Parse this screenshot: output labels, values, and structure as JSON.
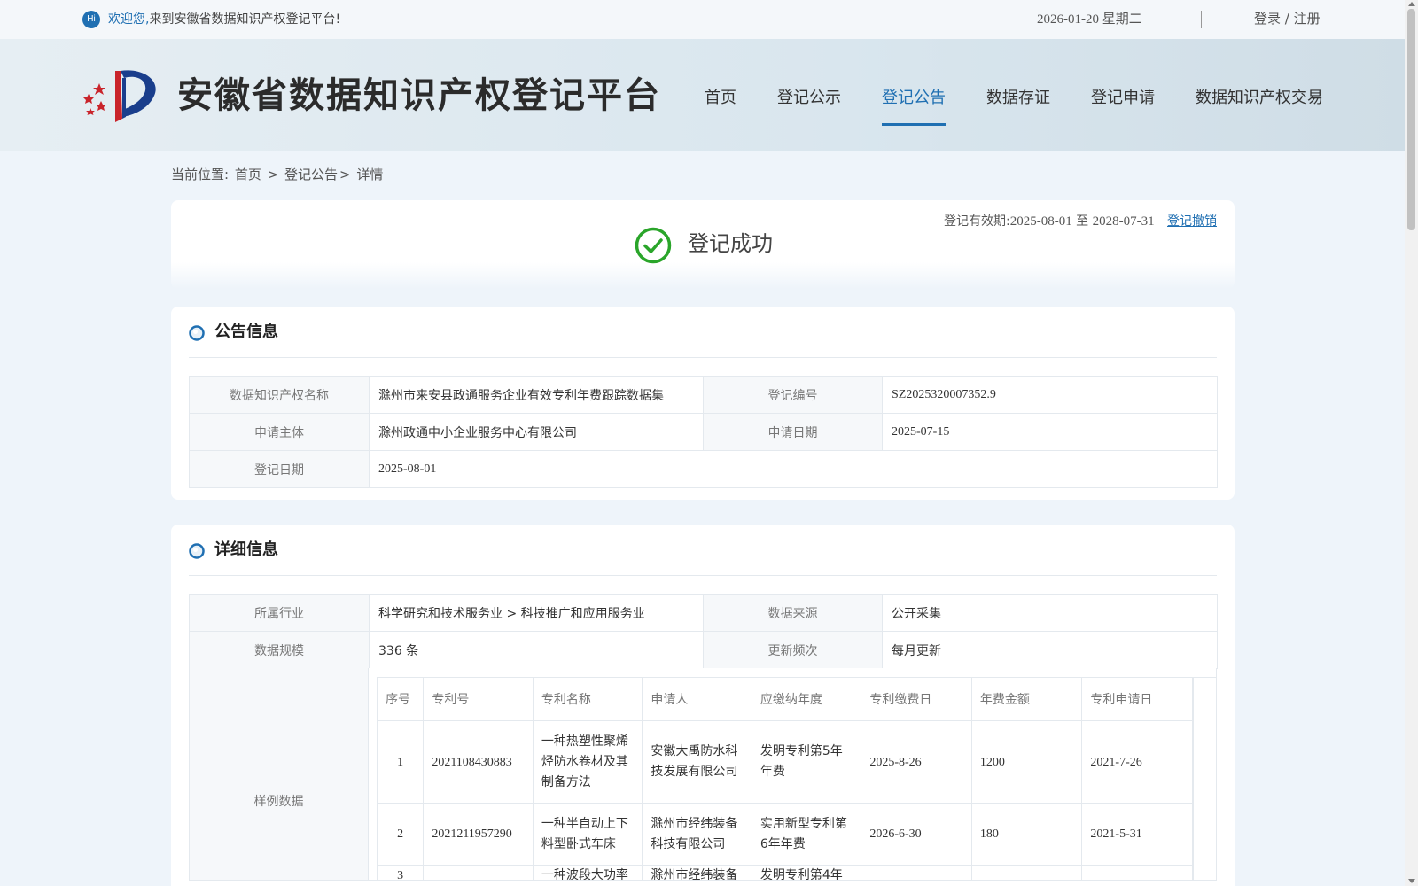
{
  "topbar": {
    "hi": "Hi",
    "welcome_highlight": "欢迎您,",
    "welcome_text": "来到安徽省数据知识产权登记平台!",
    "date": "2026-01-20 星期二",
    "separator": "|",
    "login": "登录 / 注册"
  },
  "header": {
    "title": "安徽省数据知识产权登记平台",
    "nav": [
      "首页",
      "登记公示",
      "登记公告",
      "数据存证",
      "登记申请",
      "数据知识产权交易"
    ],
    "active_nav": "登记公告",
    "accent_color": "#1f6fb2"
  },
  "breadcrumb": {
    "prefix": "当前位置:",
    "home": "首页",
    "sep1": ">",
    "section": "登记公告",
    "sep2": ">",
    "current": "详情"
  },
  "status": {
    "text": "登记成功",
    "validity_label": "登记有效期:",
    "validity_start": "2025-08-01",
    "validity_to": "至",
    "validity_end": "2028-07-31",
    "revoke": "登记撤销",
    "success_color": "#2aa52a"
  },
  "announcement": {
    "title": "公告信息",
    "name_label": "数据知识产权名称",
    "name_value": "滁州市来安县政通服务企业有效专利年费跟踪数据集",
    "reg_no_label": "登记编号",
    "reg_no_value": "SZ2025320007352.9",
    "applicant_label": "申请主体",
    "applicant_value": "滁州政通中小企业服务中心有限公司",
    "apply_date_label": "申请日期",
    "apply_date_value": "2025-07-15",
    "reg_date_label": "登记日期",
    "reg_date_value": "2025-08-01"
  },
  "detail": {
    "title": "详细信息",
    "industry_label": "所属行业",
    "industry_value": "科学研究和技术服务业 > 科技推广和应用服务业",
    "source_label": "数据来源",
    "source_value": "公开采集",
    "scale_label": "数据规模",
    "scale_value": "336 条",
    "frequency_label": "更新频次",
    "frequency_value": "每月更新",
    "sample_label": "样例数据"
  },
  "sample_table": {
    "columns": [
      "序号",
      "专利号",
      "专利名称",
      "申请人",
      "应缴纳年度",
      "专利缴费日",
      "年费金额",
      "专利申请日"
    ],
    "rows": [
      [
        "1",
        "2021108430883",
        "一种热塑性聚烯烃防水卷材及其制备方法",
        "安徽大禹防水科技发展有限公司",
        "发明专利第5年年费",
        "2025-8-26",
        "1200",
        "2021-7-26"
      ],
      [
        "2",
        "2021211957290",
        "一种半自动上下料型卧式车床",
        "滁州市经纬装备科技有限公司",
        "实用新型专利第6年年费",
        "2026-6-30",
        "180",
        "2021-5-31"
      ],
      [
        "3",
        "",
        "一种波段大功率波",
        "滁州市经纬装备",
        "发明专利第4年",
        "",
        "",
        ""
      ]
    ]
  }
}
